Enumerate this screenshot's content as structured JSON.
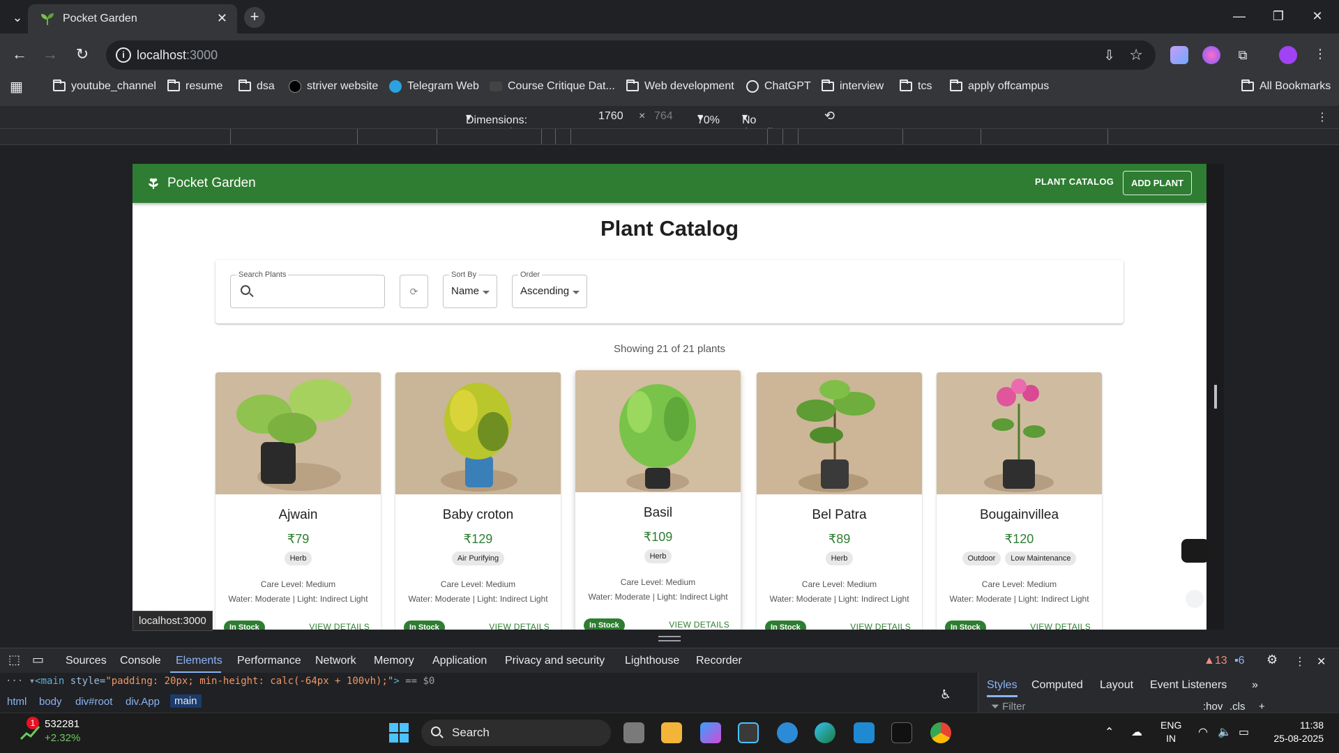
{
  "browser": {
    "tab_title": "Pocket Garden",
    "url_host": "localhost",
    "url_port": ":3000",
    "status_url": "localhost:3000"
  },
  "bookmarks": [
    {
      "label": "youtube_channel",
      "icon": "folder-icon"
    },
    {
      "label": "resume",
      "icon": "folder-icon"
    },
    {
      "label": "dsa",
      "icon": "folder-icon"
    },
    {
      "label": "striver website",
      "icon": "tuf-icon"
    },
    {
      "label": "Telegram Web",
      "icon": "telegram-icon"
    },
    {
      "label": "Course Critique Dat...",
      "icon": "course-icon"
    },
    {
      "label": "Web development",
      "icon": "folder-icon"
    },
    {
      "label": "ChatGPT",
      "icon": "chatgpt-icon"
    },
    {
      "label": "interview",
      "icon": "folder-icon"
    },
    {
      "label": "tcs",
      "icon": "folder-icon"
    },
    {
      "label": "apply offcampus",
      "icon": "folder-icon"
    }
  ],
  "all_bookmarks": "All Bookmarks",
  "device_toolbar": {
    "dimensions": "Dimensions: Responsive",
    "width": "1760",
    "times": "×",
    "height": "764",
    "zoom": "70%",
    "throttling": "No throttling"
  },
  "app": {
    "brand": "Pocket Garden",
    "nav_catalog": "PLANT CATALOG",
    "nav_add": "ADD PLANT",
    "page_title": "Plant Catalog",
    "filters": {
      "search_label": "Search Plants",
      "search_placeholder": "",
      "sort_label": "Sort By",
      "sort_value": "Name",
      "order_label": "Order",
      "order_value": "Ascending"
    },
    "showing": "Showing 21 of 21 plants",
    "cards": [
      {
        "name": "Ajwain",
        "price": "₹79",
        "tags": [
          "Herb"
        ],
        "care": "Care Level: Medium",
        "water": "Water: Moderate | Light: Indirect Light",
        "stock": "In Stock",
        "details": "VIEW DETAILS"
      },
      {
        "name": "Baby croton",
        "price": "₹129",
        "tags": [
          "Air Purifying"
        ],
        "care": "Care Level: Medium",
        "water": "Water: Moderate | Light: Indirect Light",
        "stock": "In Stock",
        "details": "VIEW DETAILS"
      },
      {
        "name": "Basil",
        "price": "₹109",
        "tags": [
          "Herb"
        ],
        "care": "Care Level: Medium",
        "water": "Water: Moderate | Light: Indirect Light",
        "stock": "In Stock",
        "details": "VIEW DETAILS"
      },
      {
        "name": "Bel Patra",
        "price": "₹89",
        "tags": [
          "Herb"
        ],
        "care": "Care Level: Medium",
        "water": "Water: Moderate | Light: Indirect Light",
        "stock": "In Stock",
        "details": "VIEW DETAILS"
      },
      {
        "name": "Bougainvillea",
        "price": "₹120",
        "tags": [
          "Outdoor",
          "Low Maintenance"
        ],
        "care": "Care Level: Medium",
        "water": "Water: Moderate | Light: Indirect Light",
        "stock": "In Stock",
        "details": "VIEW DETAILS"
      }
    ]
  },
  "devtools": {
    "tabs": [
      "Sources",
      "Console",
      "Elements",
      "Performance",
      "Network",
      "Memory",
      "Application",
      "Privacy and security",
      "Lighthouse",
      "Recorder"
    ],
    "active_tab": "Elements",
    "warnings": "13",
    "messages": "6",
    "dom_tag": "<main",
    "dom_attr": " style=",
    "dom_value": "\"padding: 20px; min-height: calc(-64px + 100vh);\"",
    "dom_close": ">",
    "dom_eq": " == $0",
    "breadcrumbs": [
      "html",
      "body",
      "div#root",
      "div.App",
      "main"
    ],
    "style_tabs": [
      "Styles",
      "Computed",
      "Layout",
      "Event Listeners"
    ],
    "filter_placeholder": "Filter",
    "hov": ":hov",
    "cls": ".cls"
  },
  "taskbar": {
    "stock_value": "532281",
    "stock_change": "+2.32%",
    "stock_badge": "1",
    "search": "Search",
    "lang1": "ENG",
    "lang2": "IN",
    "time": "11:38",
    "date": "25-08-2025"
  },
  "colors": {
    "brand_green": "#2e7d32",
    "devtools_accent": "#8ab4f8"
  }
}
